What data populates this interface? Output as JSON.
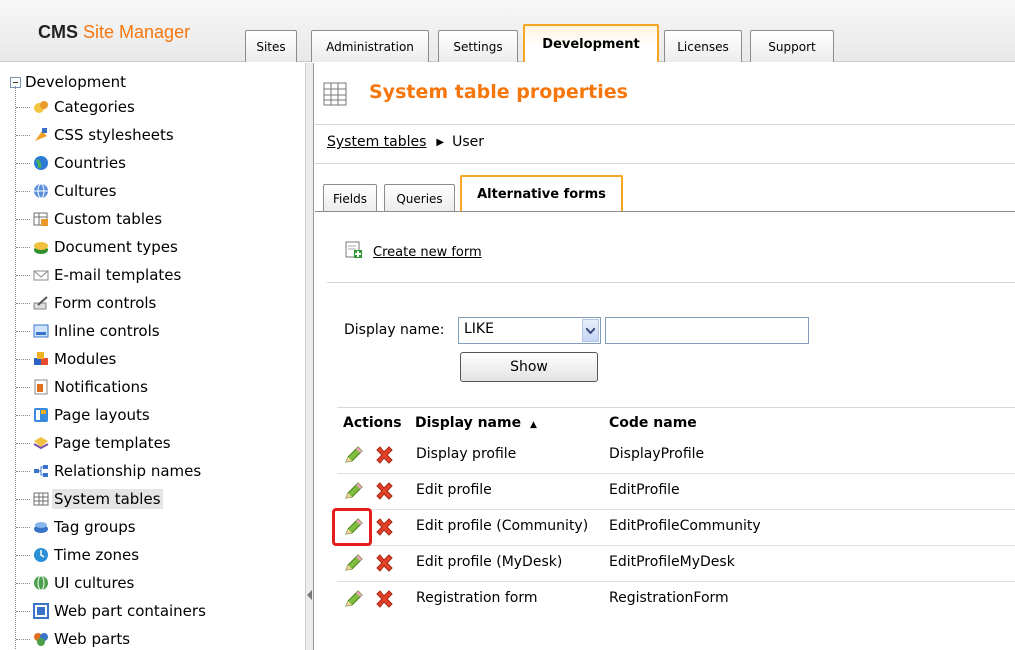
{
  "header": {
    "logo_prefix": "CMS",
    "logo_suffix": "Site Manager",
    "tabs": [
      {
        "label": "Sites"
      },
      {
        "label": "Administration"
      },
      {
        "label": "Settings"
      },
      {
        "label": "Development",
        "active": true
      },
      {
        "label": "Licenses"
      },
      {
        "label": "Support"
      }
    ]
  },
  "sidebar": {
    "root_label": "Development",
    "items": [
      {
        "label": "Categories",
        "icon": "categories-icon"
      },
      {
        "label": "CSS stylesheets",
        "icon": "css-stylesheets-icon"
      },
      {
        "label": "Countries",
        "icon": "globe-icon"
      },
      {
        "label": "Cultures",
        "icon": "cultures-icon"
      },
      {
        "label": "Custom tables",
        "icon": "custom-tables-icon"
      },
      {
        "label": "Document types",
        "icon": "document-types-icon"
      },
      {
        "label": "E-mail templates",
        "icon": "email-icon"
      },
      {
        "label": "Form controls",
        "icon": "form-controls-icon"
      },
      {
        "label": "Inline controls",
        "icon": "inline-controls-icon"
      },
      {
        "label": "Modules",
        "icon": "modules-icon"
      },
      {
        "label": "Notifications",
        "icon": "notifications-icon"
      },
      {
        "label": "Page layouts",
        "icon": "page-layouts-icon"
      },
      {
        "label": "Page templates",
        "icon": "page-templates-icon"
      },
      {
        "label": "Relationship names",
        "icon": "relationship-icon"
      },
      {
        "label": "System tables",
        "icon": "system-tables-icon",
        "selected": true
      },
      {
        "label": "Tag groups",
        "icon": "tag-groups-icon"
      },
      {
        "label": "Time zones",
        "icon": "time-zones-icon"
      },
      {
        "label": "UI cultures",
        "icon": "ui-cultures-icon"
      },
      {
        "label": "Web part containers",
        "icon": "web-part-containers-icon"
      },
      {
        "label": "Web parts",
        "icon": "web-parts-icon"
      }
    ]
  },
  "main": {
    "title": "System table properties",
    "breadcrumb": {
      "link": "System tables",
      "current": "User"
    },
    "tabs": [
      {
        "label": "Fields"
      },
      {
        "label": "Queries"
      },
      {
        "label": "Alternative forms",
        "active": true
      }
    ],
    "create_link": "Create new form",
    "filter": {
      "label": "Display name:",
      "operator": "LIKE",
      "value": "",
      "button": "Show"
    },
    "grid": {
      "headers": {
        "actions": "Actions",
        "display_name": "Display name",
        "sort_arrow": "▲",
        "code_name": "Code name"
      },
      "rows": [
        {
          "display_name": "Display profile",
          "code_name": "DisplayProfile"
        },
        {
          "display_name": "Edit profile",
          "code_name": "EditProfile"
        },
        {
          "display_name": "Edit profile (Community)",
          "code_name": "EditProfileCommunity",
          "highlighted": true
        },
        {
          "display_name": "Edit profile (MyDesk)",
          "code_name": "EditProfileMyDesk"
        },
        {
          "display_name": "Registration form",
          "code_name": "RegistrationForm"
        }
      ]
    }
  },
  "colors": {
    "accent": "#f7760b",
    "tab_active_border": "#f5a623",
    "highlight": "#e31c1c"
  }
}
